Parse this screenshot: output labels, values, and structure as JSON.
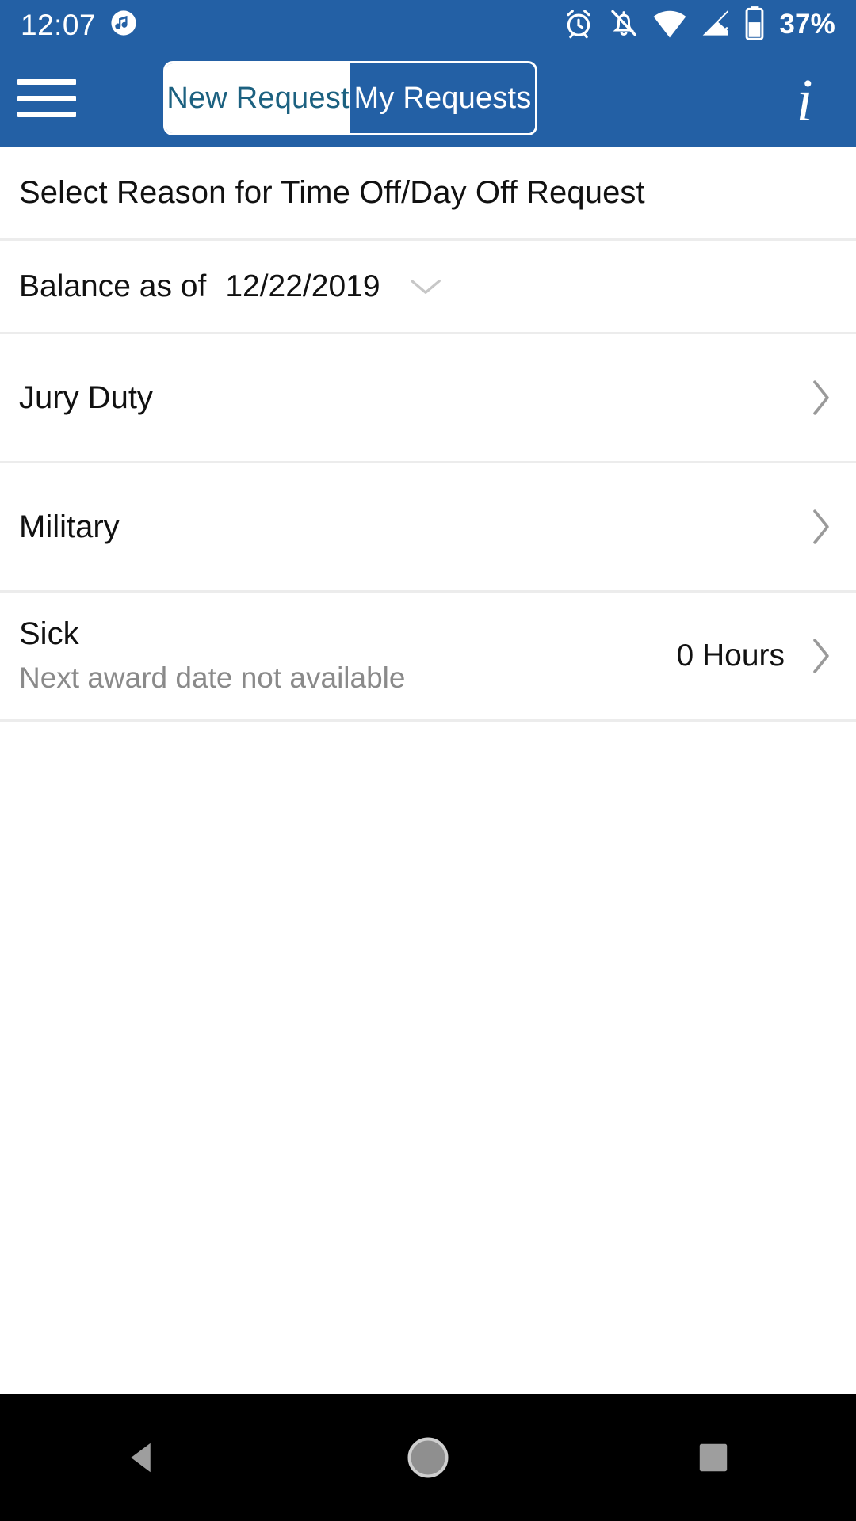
{
  "status_bar": {
    "time": "12:07",
    "battery_percent": "37%",
    "icons": [
      "music-note-icon",
      "alarm-icon",
      "notifications-off-icon",
      "wifi-icon",
      "cellular-off-icon",
      "battery-icon"
    ]
  },
  "app_bar": {
    "menu_icon": "hamburger-menu-icon",
    "info_icon": "info-icon",
    "info_glyph": "i",
    "tabs": [
      {
        "label": "New Request",
        "active": true
      },
      {
        "label": "My Requests",
        "active": false
      }
    ]
  },
  "content": {
    "section_header": "Select Reason for Time Off/Day Off Request",
    "balance": {
      "label": "Balance as of",
      "date": "12/22/2019",
      "chevron": "chevron-down-icon"
    },
    "rows": [
      {
        "title": "Jury Duty",
        "subtitle": "",
        "value": "",
        "chevron": "chevron-right-icon"
      },
      {
        "title": "Military",
        "subtitle": "",
        "value": "",
        "chevron": "chevron-right-icon"
      },
      {
        "title": "Sick",
        "subtitle": "Next award date not available",
        "value": "0 Hours",
        "chevron": "chevron-right-icon"
      }
    ]
  },
  "nav_bar": {
    "back": "back-triangle-icon",
    "home": "home-circle-icon",
    "recents": "recents-square-icon"
  },
  "colors": {
    "brand_blue": "#2360a5",
    "tab_active_text": "#1c6180",
    "divider": "#ececec",
    "subtitle_gray": "#8a8a8a",
    "chevron_gray": "#9a9a9a",
    "nav_icon_gray": "#9e9e9e"
  }
}
